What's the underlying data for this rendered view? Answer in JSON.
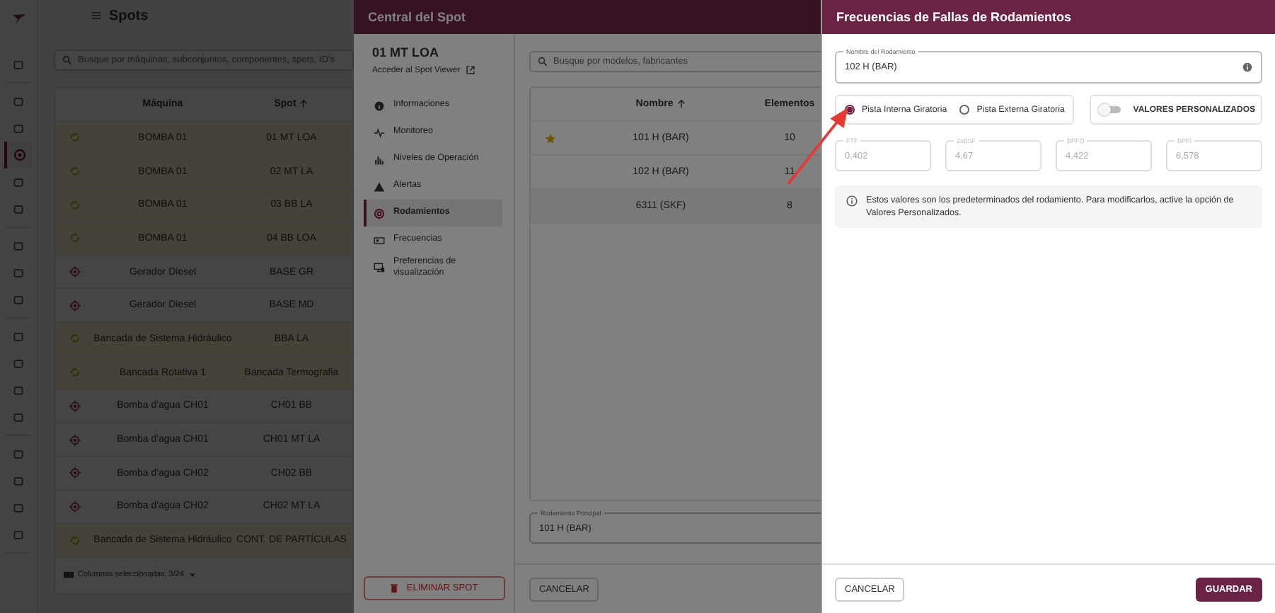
{
  "app": {
    "title": "Spots",
    "search": {
      "placeholder": "Busque por máquinas, subconjuntos, componentes, spots, ID's"
    },
    "rail_groups": [
      {
        "items": [
          {
            "selected": false
          }
        ]
      },
      {
        "items": [
          {
            "selected": false
          },
          {
            "selected": false
          },
          {
            "selected": true
          },
          {
            "selected": false
          },
          {
            "selected": false
          }
        ]
      },
      {
        "items": [
          {
            "selected": false
          },
          {
            "selected": false
          },
          {
            "selected": false
          }
        ]
      },
      {
        "items": [
          {
            "selected": false
          },
          {
            "selected": false
          },
          {
            "selected": false
          },
          {
            "selected": false
          }
        ]
      },
      {
        "items": [
          {
            "selected": false
          },
          {
            "selected": false
          },
          {
            "selected": false
          },
          {
            "selected": false
          }
        ]
      }
    ],
    "table": {
      "columns": [
        {
          "label": "Máquina",
          "sorted": false
        },
        {
          "label": "Spot",
          "sorted": true
        }
      ],
      "rows": [
        {
          "machine": "BOMBA 01",
          "spot": "01 MT LOA",
          "highlighted": true
        },
        {
          "machine": "BOMBA 01",
          "spot": "02 MT LA",
          "highlighted": true
        },
        {
          "machine": "BOMBA 01",
          "spot": "03 BB LA",
          "highlighted": true
        },
        {
          "machine": "BOMBA 01",
          "spot": "04 BB LOA",
          "highlighted": true
        },
        {
          "machine": "Gerador Diesel",
          "spot": "BASE GR",
          "highlighted": false
        },
        {
          "machine": "Gerador Diesel",
          "spot": "BASE MD",
          "highlighted": false
        },
        {
          "machine": "Bancada de Sistema Hidráulico",
          "spot": "BBA LA",
          "highlighted": true
        },
        {
          "machine": "Bancada Rotativa 1",
          "spot": "Bancada Termografia",
          "highlighted": true
        },
        {
          "machine": "Bomba d'agua CH01",
          "spot": "CH01 BB",
          "highlighted": false
        },
        {
          "machine": "Bomba d'agua CH01",
          "spot": "CH01 MT LA",
          "highlighted": false
        },
        {
          "machine": "Bomba d'agua CH02",
          "spot": "CH02 BB",
          "highlighted": false
        },
        {
          "machine": "Bomba d'agua CH02",
          "spot": "CH02 MT LA",
          "highlighted": false
        },
        {
          "machine": "Bancada de Sistema Hidráulico",
          "spot": "CONT. DE PARTÍCULAS",
          "highlighted": true
        }
      ],
      "footer": "Columnas seleccionadas: 3/24"
    }
  },
  "spot_panel": {
    "title": "Central del Spot",
    "spot_name": "01 MT LOA",
    "viewer_link": "Acceder al Spot Viewer",
    "menu": [
      {
        "label": "Informaciones",
        "selected": false
      },
      {
        "label": "Monitoreo",
        "selected": false
      },
      {
        "label": "Niveles de Operación",
        "selected": false
      },
      {
        "label": "Alertas",
        "selected": false
      },
      {
        "label": "Rodamientos",
        "selected": true
      },
      {
        "label": "Frecuencias",
        "selected": false
      },
      {
        "label": "Preferencias de visualización",
        "selected": false
      }
    ],
    "delete_button": "ELIMINAR SPOT",
    "search": {
      "placeholder": "Busque por modelos, fabricantes"
    },
    "columns": [
      {
        "label": "Nombre",
        "sorted": true
      },
      {
        "label": "Elementos",
        "sorted": false
      }
    ],
    "rows": [
      {
        "favorite": true,
        "name": "101 H (BAR)",
        "elements": "10",
        "highlighted": false
      },
      {
        "favorite": false,
        "name": "102 H (BAR)",
        "elements": "11",
        "highlighted": false
      },
      {
        "favorite": false,
        "name": "6311 (SKF)",
        "elements": "8",
        "highlighted": true
      }
    ],
    "main_bearing": {
      "label": "Rodamiento Principal",
      "value": "101 H (BAR)"
    },
    "cancel_button": "CANCELAR"
  },
  "dialog": {
    "title": "Frecuencias de Fallas de Rodamientos",
    "bearing_name": {
      "label": "Nombre del Rodamiento",
      "value": "102 H (BAR)"
    },
    "races": [
      {
        "label": "Pista Interna Giratoria",
        "selected": true
      },
      {
        "label": "Pista Externa Giratoria",
        "selected": false
      }
    ],
    "custom_values": {
      "label": "VALORES PERSONALIZADOS",
      "on": false
    },
    "frequencies": [
      {
        "label": "FTF",
        "value": "0,402",
        "disabled": true
      },
      {
        "label": "2xBSF",
        "value": "4,67",
        "disabled": true
      },
      {
        "label": "BPFO",
        "value": "4,422",
        "disabled": true
      },
      {
        "label": "BPFI",
        "value": "6,578",
        "disabled": true
      }
    ],
    "info": "Estos valores son los predeterminados del rodamiento. Para modificarlos, active la opción de Valores Personalizados.",
    "cancel_button": "CANCELAR",
    "save_button": "GUARDAR"
  }
}
